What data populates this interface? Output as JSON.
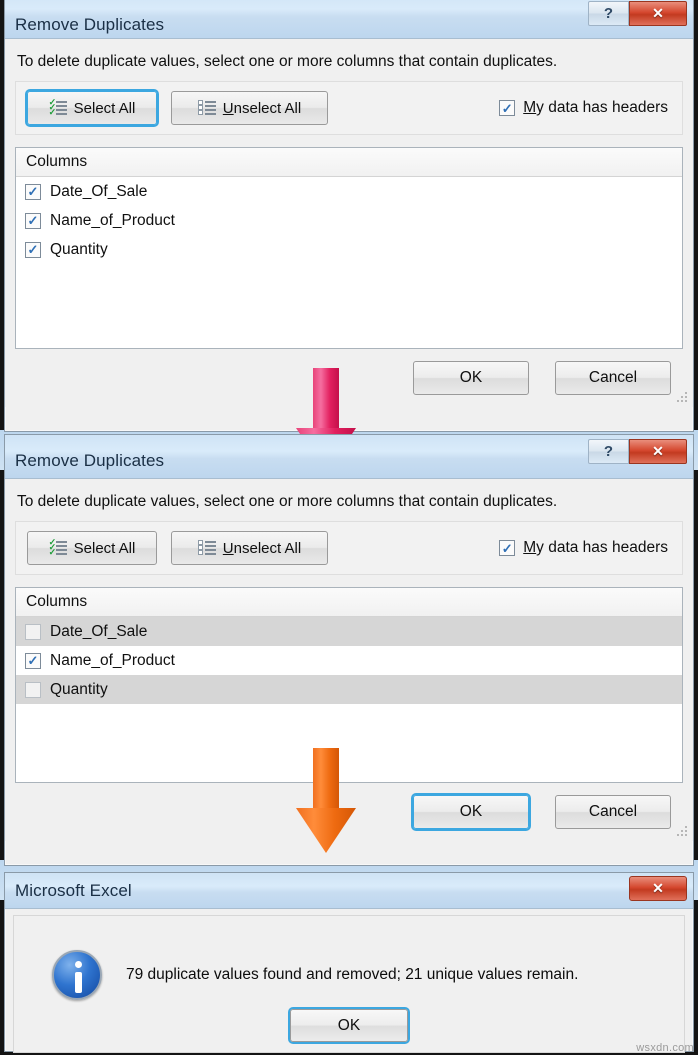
{
  "dialog1": {
    "title": "Remove Duplicates",
    "instruction": "To delete duplicate values, select one or more columns that contain duplicates.",
    "select_all_label": "Select All",
    "unselect_all_label": "Unselect All",
    "headers_checkbox": {
      "label_prefix": "M",
      "label_rest": "y data has headers",
      "checked": "✓"
    },
    "list_header": "Columns",
    "rows": [
      {
        "label": "Date_Of_Sale",
        "checked": "✓",
        "highlight": false
      },
      {
        "label": "Name_of_Product",
        "checked": "✓",
        "highlight": false
      },
      {
        "label": "Quantity",
        "checked": "✓",
        "highlight": false
      }
    ],
    "ok_label": "OK",
    "cancel_label": "Cancel",
    "help_glyph": "?",
    "close_glyph": "✕"
  },
  "dialog2": {
    "title": "Remove Duplicates",
    "instruction": "To delete duplicate values, select one or more columns that contain duplicates.",
    "select_all_label": "Select All",
    "unselect_all_label": "Unselect All",
    "headers_checkbox": {
      "label_prefix": "M",
      "label_rest": "y data has headers",
      "checked": "✓"
    },
    "list_header": "Columns",
    "rows": [
      {
        "label": "Date_Of_Sale",
        "checked": "",
        "highlight": true
      },
      {
        "label": "Name_of_Product",
        "checked": "✓",
        "highlight": false
      },
      {
        "label": "Quantity",
        "checked": "",
        "highlight": true
      }
    ],
    "ok_label": "OK",
    "cancel_label": "Cancel",
    "help_glyph": "?",
    "close_glyph": "✕"
  },
  "msgbox": {
    "title": "Microsoft Excel",
    "message": "79 duplicate values found and removed; 21 unique values remain.",
    "ok_label": "OK",
    "close_glyph": "✕",
    "duplicates_removed": 79,
    "unique_remaining": 21
  },
  "arrows": [
    {
      "name": "pink-down-arrow",
      "color": "#e2205f"
    },
    {
      "name": "orange-down-arrow",
      "color": "#ee6a10"
    }
  ],
  "watermark": "wsxdn.com"
}
